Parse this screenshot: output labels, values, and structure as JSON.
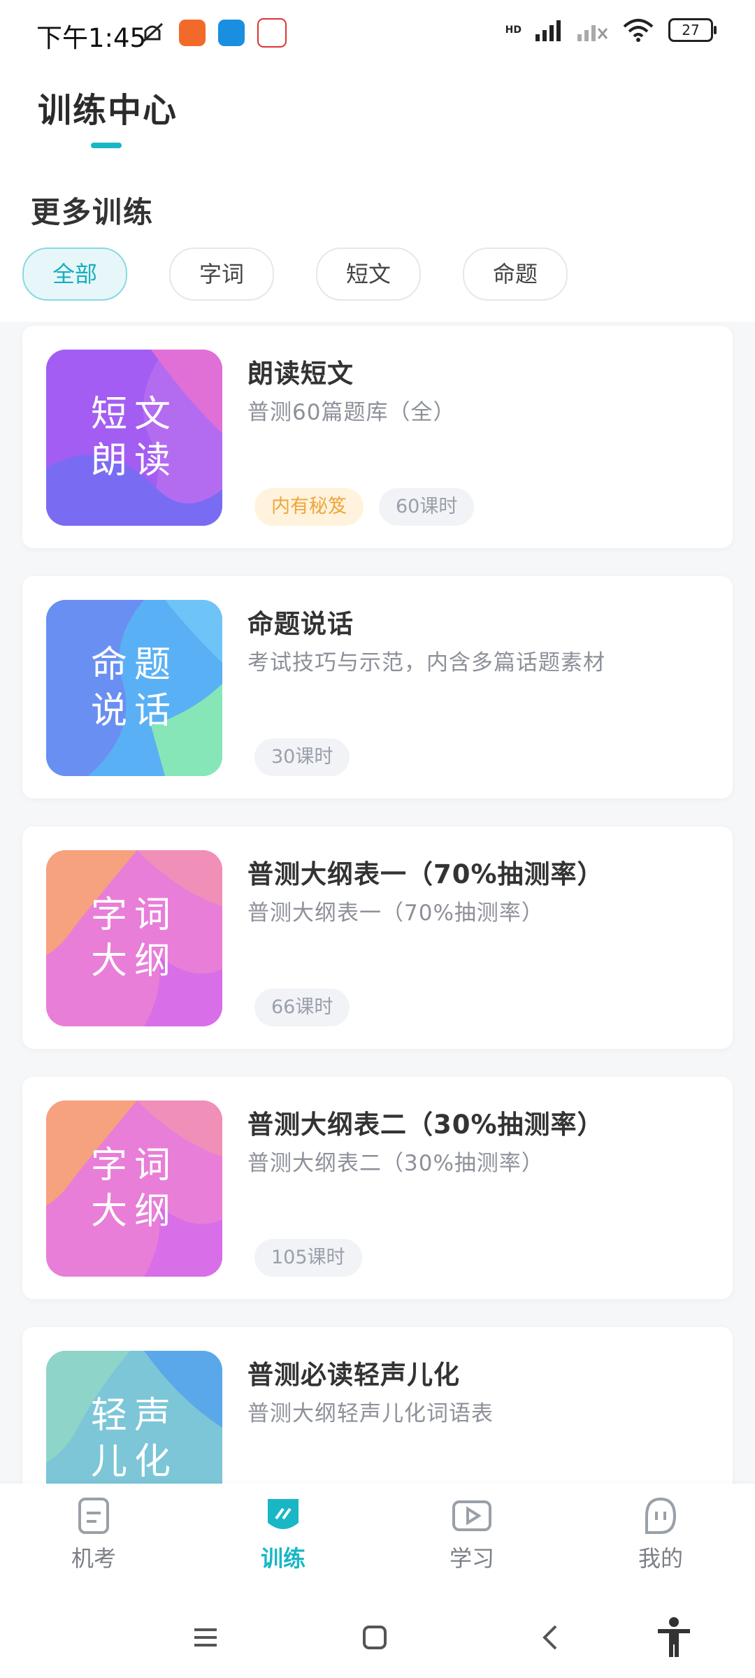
{
  "status_bar": {
    "time": "下午1:45",
    "battery": "27",
    "network": "HD"
  },
  "header": {
    "title": "训练中心"
  },
  "section": {
    "title": "更多训练"
  },
  "filters": [
    {
      "label": "全部",
      "active": true
    },
    {
      "label": "字词",
      "active": false
    },
    {
      "label": "短文",
      "active": false
    },
    {
      "label": "命题",
      "active": false
    }
  ],
  "courses": [
    {
      "thumb_line1": "短文",
      "thumb_line2": "朗读",
      "title": "朗读短文",
      "subtitle": "普测60篇题库（全）",
      "badge": "内有秘笈",
      "hours": "60课时"
    },
    {
      "thumb_line1": "命题",
      "thumb_line2": "说话",
      "title": "命题说话",
      "subtitle": "考试技巧与示范，内含多篇话题素材",
      "hours": "30课时"
    },
    {
      "thumb_line1": "字词",
      "thumb_line2": "大纲",
      "title": "普测大纲表一（70%抽测率）",
      "subtitle": "普测大纲表一（70%抽测率）",
      "hours": "66课时"
    },
    {
      "thumb_line1": "字词",
      "thumb_line2": "大纲",
      "title": "普测大纲表二（30%抽测率）",
      "subtitle": "普测大纲表二（30%抽测率）",
      "hours": "105课时"
    },
    {
      "thumb_line1": "轻声",
      "thumb_line2": "儿化",
      "title": "普测必读轻声儿化",
      "subtitle": "普测大纲轻声儿化词语表"
    }
  ],
  "tabbar": {
    "items": [
      {
        "label": "机考",
        "icon": "document-icon"
      },
      {
        "label": "训练",
        "icon": "train-icon",
        "active": true
      },
      {
        "label": "学习",
        "icon": "play-icon"
      },
      {
        "label": "我的",
        "icon": "profile-icon"
      }
    ]
  },
  "colors": {
    "accent": "#19b6c6",
    "badge_gold": "#f0a53a"
  }
}
